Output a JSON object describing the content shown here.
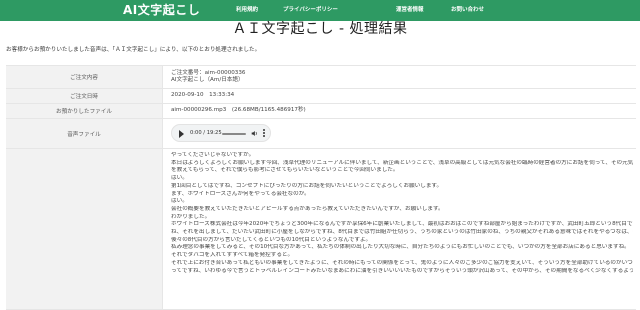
{
  "header": {
    "logo": "AI文字起こし",
    "nav": [
      {
        "label": "利用規約"
      },
      {
        "label": "プライバシーポリシー"
      },
      {
        "label": "運営者情報"
      },
      {
        "label": "お問い合わせ"
      }
    ],
    "colors": {
      "header_bg": "#2e9a63",
      "header_text": "#ffffff"
    }
  },
  "page": {
    "title": "ＡＩ文字起こし - 処理結果",
    "intro": "お客様からお預かりいたしました音声は、「ＡＩ文字起こし」により、以下のとおり処理されました。"
  },
  "table": {
    "order": {
      "label": "ご注文内容",
      "order_number": "ご注文番号：aim-00000336",
      "product": "AI文字起こし（Am/日本語）"
    },
    "date": {
      "label": "ご注文日時",
      "value": "2020-09-10　13:33:34"
    },
    "file": {
      "label": "お預かりしたファイル",
      "value": "aim-00000296.mp3　(26.68MB/1165.486917秒)"
    },
    "audio": {
      "label": "音声ファイル",
      "time": "0:00 / 19:25",
      "icons": {
        "play": "play-icon",
        "volume": "volume-icon",
        "more": "more-options-icon"
      }
    },
    "transcript": {
      "label": "テキスト",
      "lines": [
        "やってくださいじゃないですか。",
        "本日はよろしくよろしくお願いします今回、浅草代理のリニューアルに伴いまして、新企画ということで、浅草の高級としては元気な会社の臨時の経営者の方にお話を伺って、その元気の事",
        "を教えてもらって、それで僕らも影考にさせてもらいたいなということで今回伺いました。",
        "はい。",
        "第1回目としてはですね、コンセプトにぴったりの方にお話を伺いたいということでよろしくお願いします。",
        "まず、ホワイトローズさんが何をやってる会社なのか。",
        "はい。",
        "会社の概要を教えていただきたいとアピールする点があったら教えていただきたいんですが、お願いします。",
        "わかりました。",
        "ホワイトローズ株式会社は今年2020年でちょうど300年になるんですが享保6年に創業いたしまして、最初はおおばこのですね部屋から始まったわけですが、武田町五郎という8代目です",
        "ね、それを出しまして、だいたい武田町に小屋をしながらですね、8代目までは竹田組が仕切らう、うちの家というのは竹田家のね、うちの親父がそれある意味ではそれをやるつなは、そのほかはもう一代目の方くら",
        "後々の8代目の方から言いだしてくるといつもの10代目というようなんですよ。",
        "私み理念の事業をしてみると、その10代目な方があって、私たちの体制の出したり大切な時に、自分たちのようにもお忙しいのことでも、いつかの方を全部お店にあると思いますね。",
        "それでタバコを入れてすすべて箱を発控すると。",
        "それで上にお付き合いあって私どもいの事業をしてきたように、それの時にもっての関係をとって、鬼のように人々のご多少のご協力を支えいて、そういう方を全部助けているのがいつもあって、その上に参動交代の道中",
        "ってですね、いわゆる今で言うとトラベルレインコートみたいなまあにわに油を引きいいいいたものですからそういう頭が沢山あって、その中から、その期間をなるべく少なくするような形でね、そういう参勤交代"
      ]
    }
  }
}
